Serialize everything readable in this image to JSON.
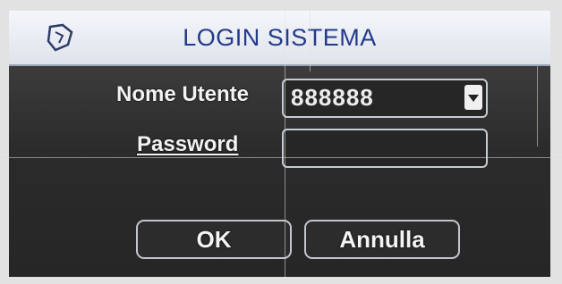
{
  "window": {
    "title": "LOGIN SISTEMA",
    "logo_icon": "shield-icon"
  },
  "form": {
    "username_label": "Nome Utente",
    "username_value": "888888",
    "password_label": "Password",
    "password_value": ""
  },
  "buttons": {
    "ok_label": "OK",
    "cancel_label": "Annulla"
  },
  "colors": {
    "title": "#233a8a",
    "panel": "#2b2b2b",
    "text": "#f2f2f2"
  }
}
